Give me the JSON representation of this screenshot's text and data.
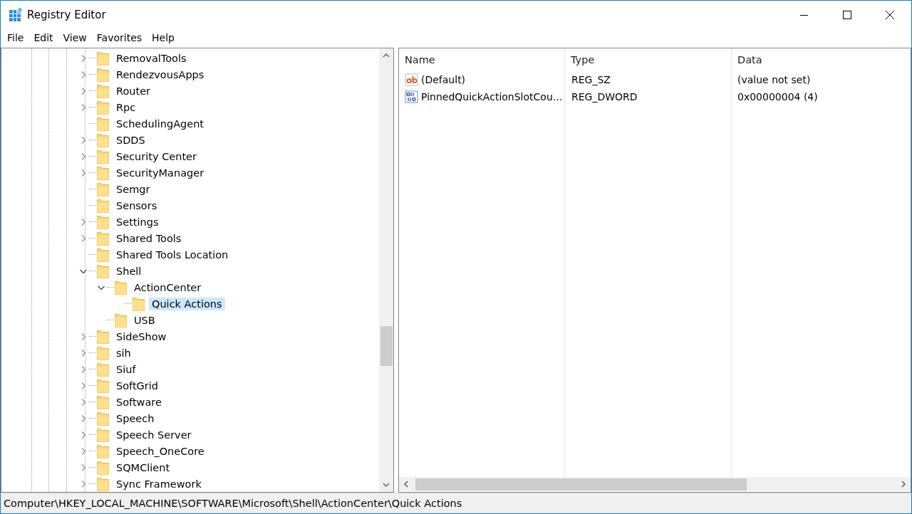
{
  "window": {
    "title": "Registry Editor"
  },
  "menu": [
    "File",
    "Edit",
    "View",
    "Favorites",
    "Help"
  ],
  "tree": [
    {
      "name": "RemovalTools",
      "expanded": false,
      "selected": false
    },
    {
      "name": "RendezvousApps",
      "expanded": false,
      "selected": false
    },
    {
      "name": "Router",
      "expanded": false,
      "selected": false
    },
    {
      "name": "Rpc",
      "expanded": false,
      "selected": false
    },
    {
      "name": "SchedulingAgent",
      "selected": false
    },
    {
      "name": "SDDS",
      "expanded": false,
      "selected": false
    },
    {
      "name": "Security Center",
      "expanded": false,
      "selected": false
    },
    {
      "name": "SecurityManager",
      "expanded": false,
      "selected": false
    },
    {
      "name": "Semgr",
      "selected": false
    },
    {
      "name": "Sensors",
      "selected": false
    },
    {
      "name": "Settings",
      "expanded": false,
      "selected": false
    },
    {
      "name": "Shared Tools",
      "expanded": false,
      "selected": false
    },
    {
      "name": "Shared Tools Location",
      "selected": false
    },
    {
      "name": "Shell",
      "expanded": true,
      "selected": false,
      "children": [
        {
          "name": "ActionCenter",
          "expanded": true,
          "selected": false,
          "children": [
            {
              "name": "Quick Actions",
              "selected": true
            }
          ]
        },
        {
          "name": "USB",
          "selected": false
        }
      ]
    },
    {
      "name": "SideShow",
      "expanded": false,
      "selected": false
    },
    {
      "name": "sih",
      "expanded": false,
      "selected": false
    },
    {
      "name": "Siuf",
      "expanded": false,
      "selected": false
    },
    {
      "name": "SoftGrid",
      "expanded": false,
      "selected": false
    },
    {
      "name": "Software",
      "expanded": false,
      "selected": false
    },
    {
      "name": "Speech",
      "expanded": false,
      "selected": false
    },
    {
      "name": "Speech Server",
      "expanded": false,
      "selected": false
    },
    {
      "name": "Speech_OneCore",
      "expanded": false,
      "selected": false
    },
    {
      "name": "SQMClient",
      "expanded": false,
      "selected": false
    },
    {
      "name": "Sync Framework",
      "expanded": false,
      "selected": false
    }
  ],
  "values": {
    "columns": [
      "Name",
      "Type",
      "Data"
    ],
    "rows": [
      {
        "kind": "string",
        "name": "(Default)",
        "type": "REG_SZ",
        "data": "(value not set)"
      },
      {
        "kind": "dword",
        "name": "PinnedQuickActionSlotCou...",
        "type": "REG_DWORD",
        "data": "0x00000004 (4)"
      }
    ]
  },
  "status_bar": "Computer\\HKEY_LOCAL_MACHINE\\SOFTWARE\\Microsoft\\Shell\\ActionCenter\\Quick Actions"
}
